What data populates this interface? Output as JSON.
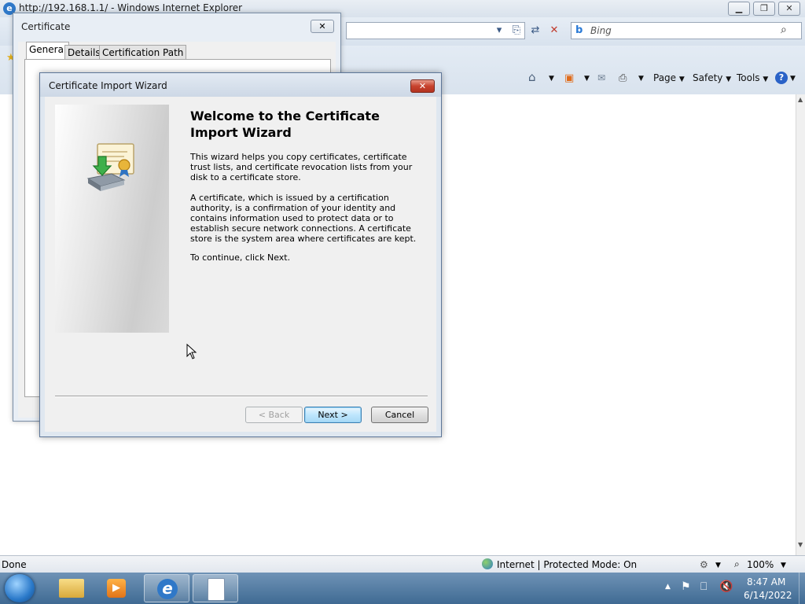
{
  "ie": {
    "title": "http://192.168.1.1/ - Windows Internet Explorer",
    "search_placeholder": "Bing",
    "menu": {
      "page": "Page",
      "safety": "Safety",
      "tools": "Tools"
    },
    "status": "Done",
    "zone": "Internet | Protected Mode: On",
    "zoom": "100%"
  },
  "certificate_dialog": {
    "title": "Certificate",
    "tabs": [
      "General",
      "Details",
      "Certification Path"
    ]
  },
  "wizard": {
    "title": "Certificate Import Wizard",
    "heading": "Welcome to the Certificate Import Wizard",
    "paragraphs": [
      "This wizard helps you copy certificates, certificate trust lists, and certificate revocation lists from your disk to a certificate store.",
      "A certificate, which is issued by a certification authority, is a confirmation of your identity and contains information used to protect data or to establish secure network connections. A certificate store is the system area where certificates are kept.",
      "To continue, click Next."
    ],
    "buttons": {
      "back": "< Back",
      "next": "Next >",
      "cancel": "Cancel"
    }
  },
  "taskbar": {
    "time": "8:47 AM",
    "date": "6/14/2022"
  },
  "colors": {
    "accent": "#2f78c8",
    "taskbar": "#4f7aa3",
    "wizard_close": "#c8432e"
  }
}
